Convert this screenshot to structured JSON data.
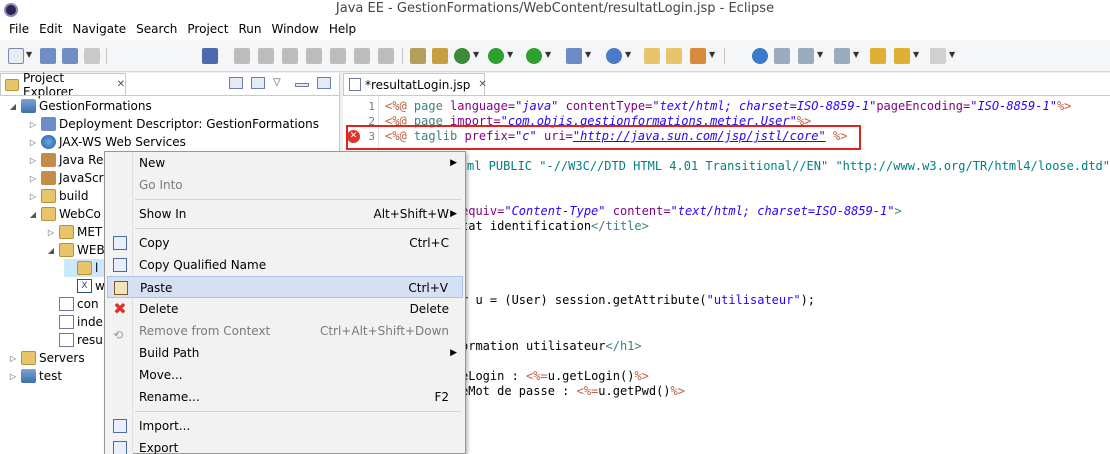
{
  "window": {
    "title": "Java EE - GestionFormations/WebContent/resultatLogin.jsp - Eclipse"
  },
  "menubar": [
    "File",
    "Edit",
    "Navigate",
    "Search",
    "Project",
    "Run",
    "Window",
    "Help"
  ],
  "explorer": {
    "tab_label": "Project Explorer",
    "tree": [
      {
        "label": "GestionFormations",
        "icon": "project-icon",
        "depth": 0,
        "twisty": "expanded"
      },
      {
        "label": "Deployment Descriptor: GestionFormations",
        "icon": "descriptor-icon",
        "depth": 1,
        "twisty": "collapsed"
      },
      {
        "label": "JAX-WS Web Services",
        "icon": "globe-icon",
        "depth": 1,
        "twisty": "collapsed"
      },
      {
        "label": "Java Res",
        "icon": "jar-icon",
        "depth": 1,
        "twisty": "collapsed"
      },
      {
        "label": "JavaScri",
        "icon": "jar-icon",
        "depth": 1,
        "twisty": "collapsed"
      },
      {
        "label": "build",
        "icon": "folder-icon",
        "depth": 1,
        "twisty": "collapsed"
      },
      {
        "label": "WebCo",
        "icon": "folder-icon",
        "depth": 1,
        "twisty": "expanded"
      },
      {
        "label": "MET",
        "icon": "folder-icon",
        "depth": 2,
        "twisty": "collapsed"
      },
      {
        "label": "WEB",
        "icon": "folder-icon",
        "depth": 2,
        "twisty": "expanded"
      },
      {
        "label": "l",
        "icon": "folder-icon",
        "depth": 3,
        "twisty": "none",
        "selected": true
      },
      {
        "label": "w",
        "icon": "xml-icon",
        "depth": 3,
        "twisty": "none"
      },
      {
        "label": "con",
        "icon": "file-icon",
        "depth": 2,
        "twisty": "none"
      },
      {
        "label": "inde",
        "icon": "file-icon",
        "depth": 2,
        "twisty": "none"
      },
      {
        "label": "resu",
        "icon": "file-icon",
        "depth": 2,
        "twisty": "none"
      },
      {
        "label": "Servers",
        "icon": "folder-icon",
        "depth": 0,
        "twisty": "collapsed"
      },
      {
        "label": "test",
        "icon": "project-icon",
        "depth": 0,
        "twisty": "collapsed"
      }
    ]
  },
  "editor": {
    "tab_label": "*resultatLogin.jsp",
    "line_numbers": [
      "1",
      "2",
      "3"
    ],
    "lines": {
      "l1": {
        "a": "<%@ ",
        "b": "page ",
        "c": "language=",
        "d": "\"java\"",
        "e": " contentType=",
        "f": "\"text/html; charset=ISO-8859-1\"",
        "g": "pageEncoding=",
        "h": "\"ISO-8859-1\"",
        "i": "%>"
      },
      "l2": {
        "a": "<%@ ",
        "b": "page ",
        "c": "import=",
        "d": "\"com.objis.gestionformations.metier.User\"",
        "e": "%>"
      },
      "l3": {
        "a": "<%@ ",
        "b": "taglib ",
        "c": "prefix=",
        "d": "\"c\"",
        "e": " uri=",
        "f": "\"http://java.sun.com/jsp/jstl/core\"",
        "g": " %>"
      },
      "l4": {
        "a": "ml PUBLIC \"-//W3C//DTD HTML 4.01 Transitional//EN\" \"http://www.w3.org/TR/html4/loose.dtd\">"
      },
      "l5": {
        "a": "equiv=",
        "b": "\"Content-Type\"",
        "c": " content=",
        "d": "\"text/html; charset=ISO-8859-1\"",
        "e": ">"
      },
      "l6": {
        "a": "tat identification",
        "b": "</title>"
      },
      "l7": {
        "a": "r u = (User) session.getAttribute(",
        "b": "\"utilisateur\"",
        "c": ");"
      },
      "l8": {
        "a": "ormation utilisateur",
        "b": "</h1>"
      },
      "l9": {
        "a": "eLogin : ",
        "b": "<%=",
        "c": "u.getLogin()",
        "d": "%>"
      },
      "l10": {
        "a": "eMot de passe : ",
        "b": "<%=",
        "c": "u.getPwd()",
        "d": "%>"
      }
    }
  },
  "context_menu": {
    "items": [
      {
        "label": "New",
        "submenu": true
      },
      {
        "label": "Go Into",
        "disabled": true
      },
      {
        "label": "Show In",
        "accelerator": "Alt+Shift+W",
        "submenu": true
      },
      {
        "label": "Copy",
        "accelerator": "Ctrl+C",
        "icon": "copy-icon"
      },
      {
        "label": "Copy Qualified Name",
        "icon": "copy-icon"
      },
      {
        "label": "Paste",
        "accelerator": "Ctrl+V",
        "icon": "paste-icon",
        "hover": true
      },
      {
        "label": "Delete",
        "accelerator": "Delete",
        "icon": "delete-icon"
      },
      {
        "label": "Remove from Context",
        "accelerator": "Ctrl+Alt+Shift+Down",
        "icon": "remove-icon",
        "disabled": true
      },
      {
        "label": "Build Path",
        "submenu": true
      },
      {
        "label": "Move..."
      },
      {
        "label": "Rename...",
        "accelerator": "F2"
      },
      {
        "label": "Import...",
        "icon": "import-icon"
      },
      {
        "label": "Export"
      }
    ]
  },
  "colors": {
    "error": "#e2231a",
    "selection": "#cce8ff",
    "menu_hover": "#d5e1f2"
  }
}
